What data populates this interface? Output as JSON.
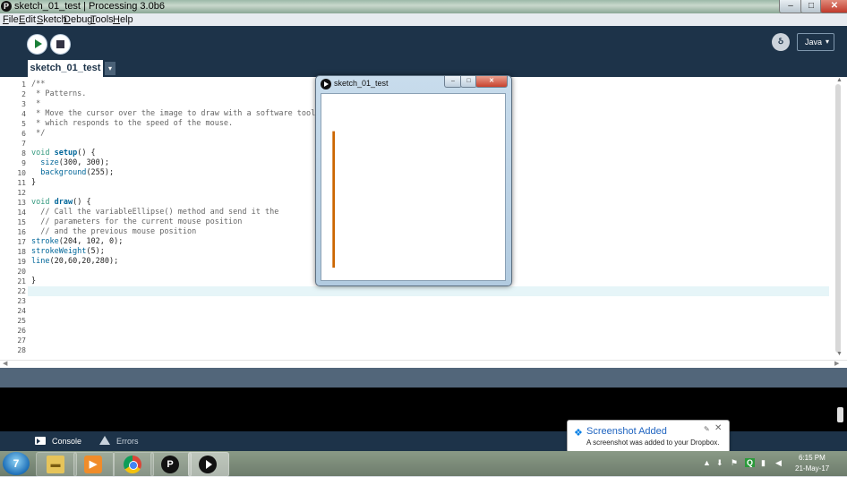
{
  "window": {
    "title": "sketch_01_test | Processing 3.0b6",
    "app_icon": "processing-logo-icon",
    "minimize": "–",
    "maximize": "□",
    "close": "✕"
  },
  "menu": [
    "File",
    "Edit",
    "Sketch",
    "Debug",
    "Tools",
    "Help"
  ],
  "toolbar": {
    "run_icon": "play-icon",
    "stop_icon": "stop-icon",
    "debugger_icon": "debugger-icon",
    "mode": "Java",
    "mode_chevron": "▾"
  },
  "tabs": {
    "active": "sketch_01_test",
    "menu_arrow": "▾"
  },
  "editor": {
    "line_numbers": [
      "1",
      "2",
      "3",
      "4",
      "5",
      "6",
      "7",
      "8",
      "9",
      "10",
      "11",
      "12",
      "13",
      "14",
      "15",
      "16",
      "17",
      "18",
      "19",
      "20",
      "21",
      "22",
      "23",
      "24",
      "25",
      "26",
      "27",
      "28"
    ],
    "lines": [
      "/**",
      " * Patterns.",
      " *",
      " * Move the cursor over the image to draw with a software tool",
      " * which responds to the speed of the mouse.",
      " */",
      "",
      "void setup() {",
      "  size(300, 300);",
      "  background(255);",
      "}",
      "",
      "void draw() {",
      "  // Call the variableEllipse() method and send it the",
      "  // parameters for the current mouse position",
      "  // and the previous mouse position",
      "stroke(204, 102, 0);",
      "strokeWeight(5);",
      "line(20,60,20,280);",
      "",
      "}"
    ],
    "current_line": 22,
    "scroll_up": "▲",
    "scroll_down": "▼",
    "scroll_left": "◀",
    "scroll_right": "▶"
  },
  "console_tabs": {
    "console": "Console",
    "errors": "Errors"
  },
  "sketch_window": {
    "title": "sketch_01_test",
    "minimize": "–",
    "maximize": "□",
    "close": "✕",
    "canvas_size": [
      300,
      300
    ],
    "background": "#ffffff",
    "stroke_color": "#cc6600",
    "stroke_weight": 5,
    "line": [
      20,
      60,
      20,
      280
    ]
  },
  "notification": {
    "icon": "dropbox-icon",
    "title": "Screenshot Added",
    "body": "A screenshot was added to your Dropbox.",
    "pin": "✎",
    "close": "✕"
  },
  "taskbar": {
    "start_glyph": "7",
    "items": [
      {
        "name": "explorer",
        "icon": "folder-icon",
        "glyph": ""
      },
      {
        "name": "media",
        "icon": "media-player-icon",
        "glyph": "▶"
      },
      {
        "name": "chrome",
        "icon": "chrome-icon",
        "glyph": ""
      },
      {
        "name": "processing",
        "icon": "processing-icon",
        "glyph": "P"
      },
      {
        "name": "sketch",
        "icon": "sketch-run-icon",
        "glyph": ""
      }
    ],
    "tray": {
      "up_arrow": "▲",
      "dropbox": "⬇",
      "flag": "⚑",
      "q": "Q",
      "signal": "▮",
      "volume": "◀"
    },
    "clock": {
      "time": "6:15 PM",
      "date": "21-May-17"
    }
  },
  "colors": {
    "toolbar": "#1d3349",
    "current_line": "#e6f5f8",
    "stroke": "#cc6600"
  }
}
